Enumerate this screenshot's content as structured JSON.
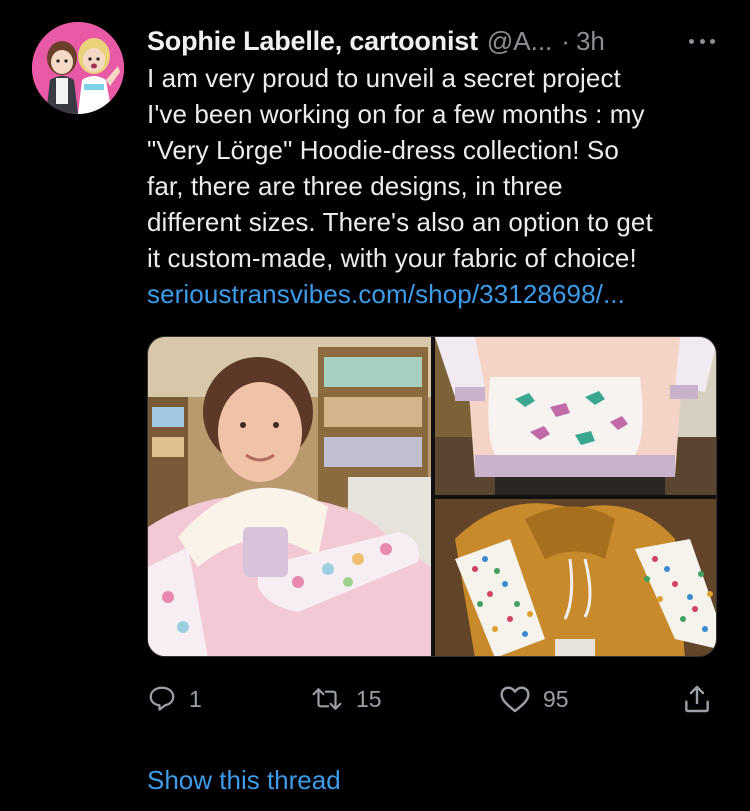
{
  "author": {
    "name": "Sophie Labelle, cartoonist",
    "handle": "@A...",
    "separator": "·",
    "time": "3h"
  },
  "tweet": {
    "lines": [
      "I am very proud to unveil a secret project",
      "I've been working on for a few months : my",
      "\"Very Lörge\" Hoodie-dress collection! So",
      "far, there are three designs, in three",
      "different sizes. There's also an option to get",
      "it custom-made, with your fabric of choice!"
    ],
    "link": "serioustransvibes.com/shop/33128698/..."
  },
  "media": {
    "images": [
      {
        "icon": "photo-person-pink-hoodie-dress"
      },
      {
        "icon": "photo-dinosaur-pocket-hoodie"
      },
      {
        "icon": "photo-ochre-polkadot-hoodie"
      }
    ]
  },
  "actions": {
    "reply_count": "1",
    "retweet_count": "15",
    "like_count": "95"
  },
  "footer": {
    "show_thread": "Show this thread"
  },
  "colors": {
    "background": "#000000",
    "link": "#3d9bea",
    "secondary": "#8b8f94",
    "text": "#ececec"
  }
}
